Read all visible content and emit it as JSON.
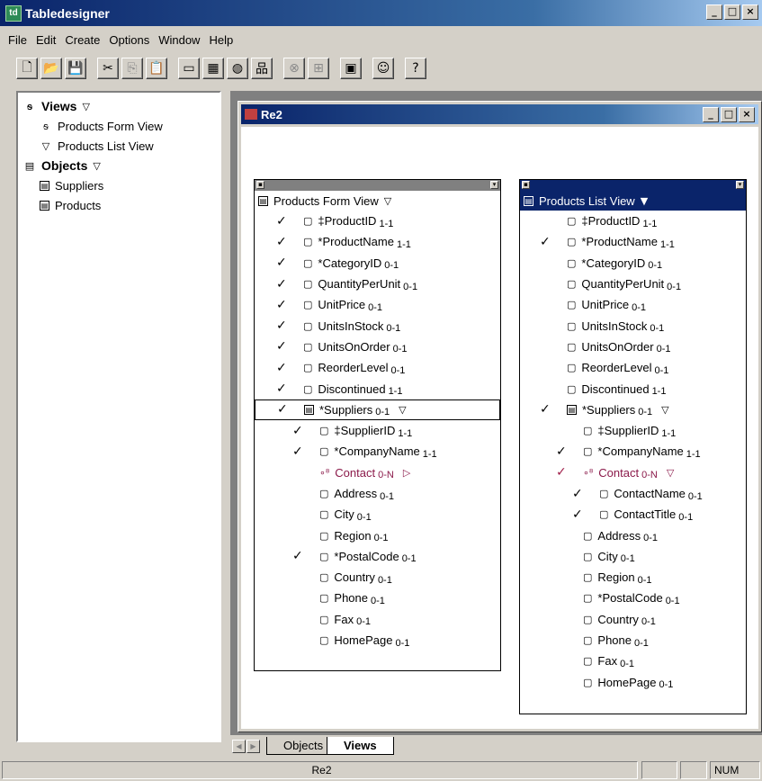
{
  "app": {
    "title": "Tabledesigner",
    "icon_label": "td"
  },
  "menu": [
    "File",
    "Edit",
    "Create",
    "Options",
    "Window",
    "Help"
  ],
  "toolbar": {
    "groups": [
      [
        "new-icon",
        "open-icon",
        "save-icon"
      ],
      [
        "cut-icon",
        "copy-icon",
        "paste-icon"
      ],
      [
        "form-icon",
        "table-icon",
        "object-icon",
        "hierarchy-icon"
      ],
      [
        "link-icon",
        "layout-icon"
      ],
      [
        "properties-icon"
      ],
      [
        "comment-icon"
      ],
      [
        "help-icon"
      ]
    ]
  },
  "tree": {
    "views_label": "Views",
    "views": [
      "Products Form View",
      "Products List View"
    ],
    "objects_label": "Objects",
    "objects": [
      "Suppliers",
      "Products"
    ]
  },
  "child_window": {
    "title": "Re2"
  },
  "form_view": {
    "title": "Products Form View",
    "fields": [
      {
        "name": "‡ProductID",
        "card": "1-1",
        "checked": true,
        "indent": 0,
        "kind": "field"
      },
      {
        "name": "*ProductName",
        "card": "1-1",
        "checked": true,
        "indent": 0,
        "kind": "field"
      },
      {
        "name": "*CategoryID",
        "card": "0-1",
        "checked": true,
        "indent": 0,
        "kind": "field"
      },
      {
        "name": "QuantityPerUnit",
        "card": "0-1",
        "checked": true,
        "indent": 0,
        "kind": "field"
      },
      {
        "name": "UnitPrice",
        "card": "0-1",
        "checked": true,
        "indent": 0,
        "kind": "field"
      },
      {
        "name": "UnitsInStock",
        "card": "0-1",
        "checked": true,
        "indent": 0,
        "kind": "field"
      },
      {
        "name": "UnitsOnOrder",
        "card": "0-1",
        "checked": true,
        "indent": 0,
        "kind": "field"
      },
      {
        "name": "ReorderLevel",
        "card": "0-1",
        "checked": true,
        "indent": 0,
        "kind": "field"
      },
      {
        "name": "Discontinued",
        "card": "1-1",
        "checked": true,
        "indent": 0,
        "kind": "field"
      },
      {
        "name": "*Suppliers",
        "card": "0-1",
        "checked": true,
        "indent": 0,
        "kind": "object",
        "highlight": true,
        "toggle": "down"
      },
      {
        "name": "‡SupplierID",
        "card": "1-1",
        "checked": true,
        "indent": 1,
        "kind": "field"
      },
      {
        "name": "*CompanyName",
        "card": "1-1",
        "checked": true,
        "indent": 1,
        "kind": "field"
      },
      {
        "name": "Contact",
        "card": "0-N",
        "checked": false,
        "indent": 1,
        "kind": "relation",
        "toggle": "right"
      },
      {
        "name": "Address",
        "card": "0-1",
        "checked": false,
        "indent": 1,
        "kind": "field"
      },
      {
        "name": "City",
        "card": "0-1",
        "checked": false,
        "indent": 1,
        "kind": "field"
      },
      {
        "name": "Region",
        "card": "0-1",
        "checked": false,
        "indent": 1,
        "kind": "field"
      },
      {
        "name": "*PostalCode",
        "card": "0-1",
        "checked": true,
        "indent": 1,
        "kind": "field"
      },
      {
        "name": "Country",
        "card": "0-1",
        "checked": false,
        "indent": 1,
        "kind": "field"
      },
      {
        "name": "Phone",
        "card": "0-1",
        "checked": false,
        "indent": 1,
        "kind": "field"
      },
      {
        "name": "Fax",
        "card": "0-1",
        "checked": false,
        "indent": 1,
        "kind": "field"
      },
      {
        "name": "HomePage",
        "card": "0-1",
        "checked": false,
        "indent": 1,
        "kind": "field"
      }
    ]
  },
  "list_view": {
    "title": "Products List View",
    "fields": [
      {
        "name": "‡ProductID",
        "card": "1-1",
        "checked": false,
        "indent": 0,
        "kind": "field"
      },
      {
        "name": "*ProductName",
        "card": "1-1",
        "checked": true,
        "indent": 0,
        "kind": "field"
      },
      {
        "name": "*CategoryID",
        "card": "0-1",
        "checked": false,
        "indent": 0,
        "kind": "field"
      },
      {
        "name": "QuantityPerUnit",
        "card": "0-1",
        "checked": false,
        "indent": 0,
        "kind": "field"
      },
      {
        "name": "UnitPrice",
        "card": "0-1",
        "checked": false,
        "indent": 0,
        "kind": "field"
      },
      {
        "name": "UnitsInStock",
        "card": "0-1",
        "checked": false,
        "indent": 0,
        "kind": "field"
      },
      {
        "name": "UnitsOnOrder",
        "card": "0-1",
        "checked": false,
        "indent": 0,
        "kind": "field"
      },
      {
        "name": "ReorderLevel",
        "card": "0-1",
        "checked": false,
        "indent": 0,
        "kind": "field"
      },
      {
        "name": "Discontinued",
        "card": "1-1",
        "checked": false,
        "indent": 0,
        "kind": "field"
      },
      {
        "name": "*Suppliers",
        "card": "0-1",
        "checked": true,
        "indent": 0,
        "kind": "object",
        "toggle": "down"
      },
      {
        "name": "‡SupplierID",
        "card": "1-1",
        "checked": false,
        "indent": 1,
        "kind": "field"
      },
      {
        "name": "*CompanyName",
        "card": "1-1",
        "checked": true,
        "indent": 1,
        "kind": "field"
      },
      {
        "name": "Contact",
        "card": "0-N",
        "checked": true,
        "indent": 1,
        "kind": "relation",
        "toggle": "down"
      },
      {
        "name": "ContactName",
        "card": "0-1",
        "checked": true,
        "indent": 2,
        "kind": "field"
      },
      {
        "name": "ContactTitle",
        "card": "0-1",
        "checked": true,
        "indent": 2,
        "kind": "field"
      },
      {
        "name": "Address",
        "card": "0-1",
        "checked": false,
        "indent": 1,
        "kind": "field"
      },
      {
        "name": "City",
        "card": "0-1",
        "checked": false,
        "indent": 1,
        "kind": "field"
      },
      {
        "name": "Region",
        "card": "0-1",
        "checked": false,
        "indent": 1,
        "kind": "field"
      },
      {
        "name": "*PostalCode",
        "card": "0-1",
        "checked": false,
        "indent": 1,
        "kind": "field"
      },
      {
        "name": "Country",
        "card": "0-1",
        "checked": false,
        "indent": 1,
        "kind": "field"
      },
      {
        "name": "Phone",
        "card": "0-1",
        "checked": false,
        "indent": 1,
        "kind": "field"
      },
      {
        "name": "Fax",
        "card": "0-1",
        "checked": false,
        "indent": 1,
        "kind": "field"
      },
      {
        "name": "HomePage",
        "card": "0-1",
        "checked": false,
        "indent": 1,
        "kind": "field"
      }
    ]
  },
  "tabs": [
    "Objects",
    "Views"
  ],
  "selected_tab": "Views",
  "status": {
    "doc": "Re2",
    "num": "NUM"
  },
  "colors": {
    "titlebar": "#0a246a",
    "relation": "#8b1a4a",
    "face": "#d4d0c8"
  }
}
